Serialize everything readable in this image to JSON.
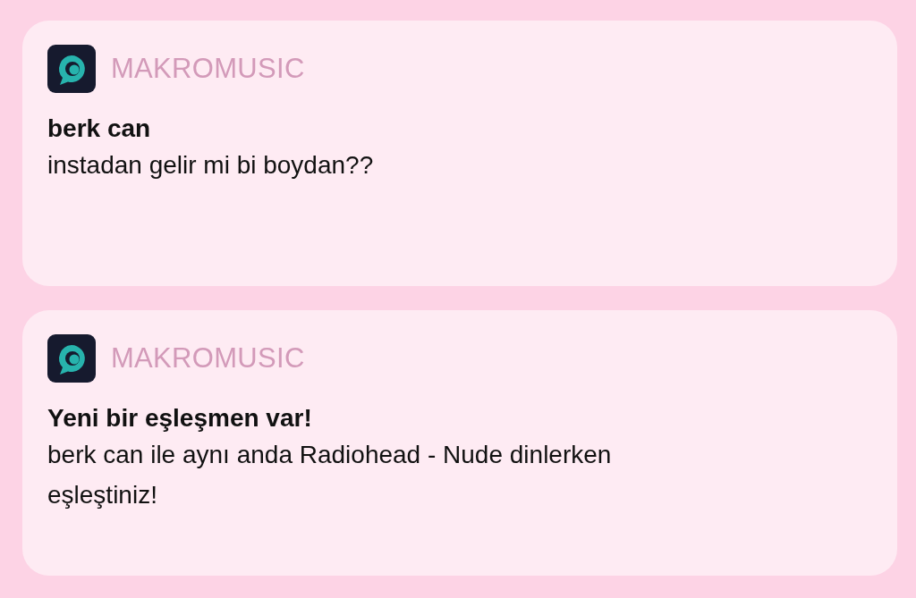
{
  "notifications": [
    {
      "app": "MAKROMUSIC",
      "title": "berk can",
      "body": "instadan gelir mi bi boydan??"
    },
    {
      "app": "MAKROMUSIC",
      "title": "Yeni bir eşleşmen var!",
      "body": "berk can ile aynı anda Radiohead - Nude dinlerken eşleştiniz!"
    }
  ]
}
